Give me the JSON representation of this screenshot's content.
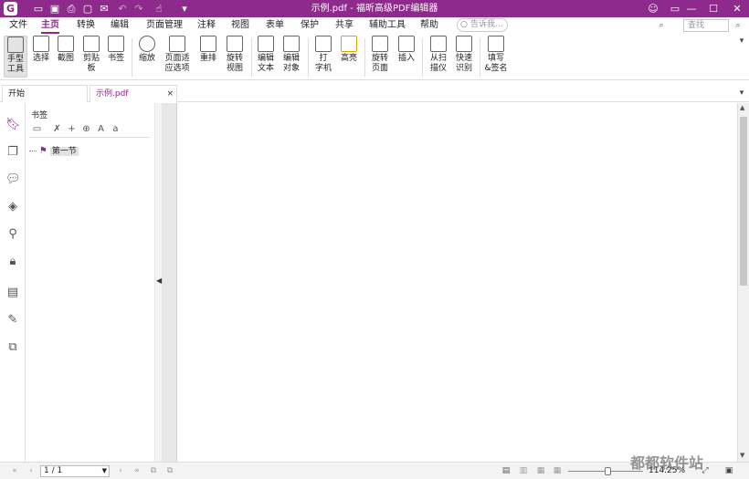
{
  "window": {
    "title": "示例.pdf - 福昕高级PDF编辑器"
  },
  "menu": [
    "文件",
    "主页",
    "转换",
    "编辑",
    "页面管理",
    "注释",
    "视图",
    "表单",
    "保护",
    "共享",
    "辅助工具",
    "帮助"
  ],
  "search": {
    "placeholder": "告诉我..."
  },
  "find": {
    "placeholder": "查找"
  },
  "ribbon": {
    "hand": "手型\n工具",
    "select": "选择",
    "snapshot": "截图",
    "clipboard": "剪贴\n板",
    "bookmark": "书签",
    "zoom": "缩放",
    "fit": "页面适\n应选项",
    "reflow": "重排",
    "rotate_view": "旋转\n视图",
    "edit_text": "编辑\n文本",
    "edit_object": "编辑\n对象",
    "typewriter": "打\n字机",
    "highlight": "高亮",
    "rotate_page": "旋转\n页面",
    "insert": "插入",
    "from_scanner": "从扫\n描仪",
    "quick_ocr": "快速\n识别",
    "fill_sign": "填写\n&签名"
  },
  "tabs": {
    "start": "开始",
    "doc": "示例.pdf",
    "close": "×"
  },
  "bookmarks": {
    "title": "书签",
    "items": [
      "第一节"
    ]
  },
  "status": {
    "page": "1 / 1",
    "zoom": "114.25%"
  },
  "watermark": "都都软件站",
  "colors": {
    "accent": "#8e2a8b"
  }
}
